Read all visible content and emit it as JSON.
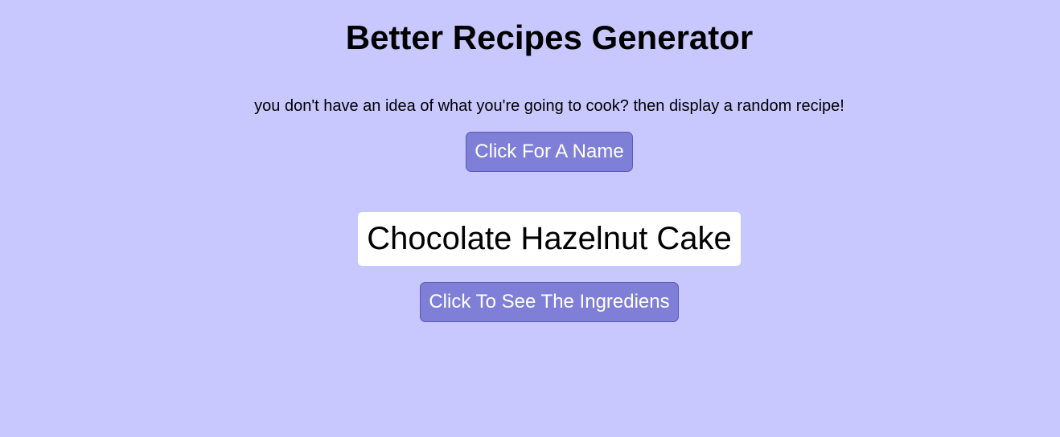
{
  "header": {
    "title": "Better Recipes Generator"
  },
  "intro": {
    "text": "you don't have an idea of what you're going to cook? then display a random recipe!"
  },
  "actions": {
    "name_button_label": "Click For A Name",
    "ingredients_button_label": "Click To See The Ingrediens"
  },
  "recipe": {
    "name": "Chocolate Hazelnut Cake"
  },
  "colors": {
    "background": "#c8c8ff",
    "button": "#7f7fd8",
    "button_border": "#5a5ab8",
    "button_text": "#ffffff",
    "recipe_box": "#ffffff"
  }
}
